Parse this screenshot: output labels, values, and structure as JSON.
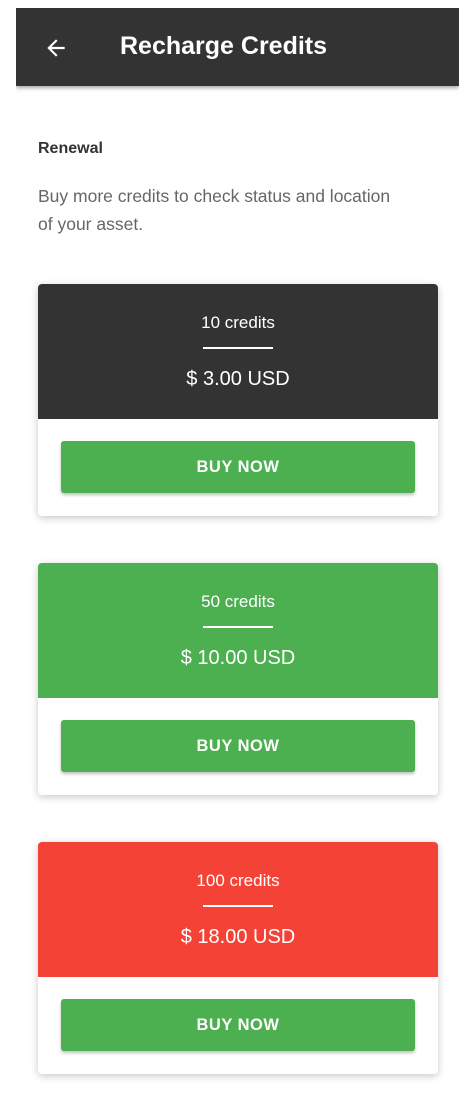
{
  "header": {
    "back_icon": "arrow-left-icon",
    "title": "Recharge Credits"
  },
  "renewal": {
    "title": "Renewal",
    "description": "Buy more credits to check status and location of your asset."
  },
  "colors": {
    "app_bar": "#333333",
    "button": "#4caf50"
  },
  "packages": [
    {
      "credits": "10 credits",
      "price": "$ 3.00 USD",
      "color": "#333333",
      "button_label": "BUY NOW"
    },
    {
      "credits": "50 credits",
      "price": "$ 10.00 USD",
      "color": "#4caf50",
      "button_label": "BUY NOW"
    },
    {
      "credits": "100 credits",
      "price": "$ 18.00 USD",
      "color": "#f44336",
      "button_label": "BUY NOW"
    }
  ]
}
